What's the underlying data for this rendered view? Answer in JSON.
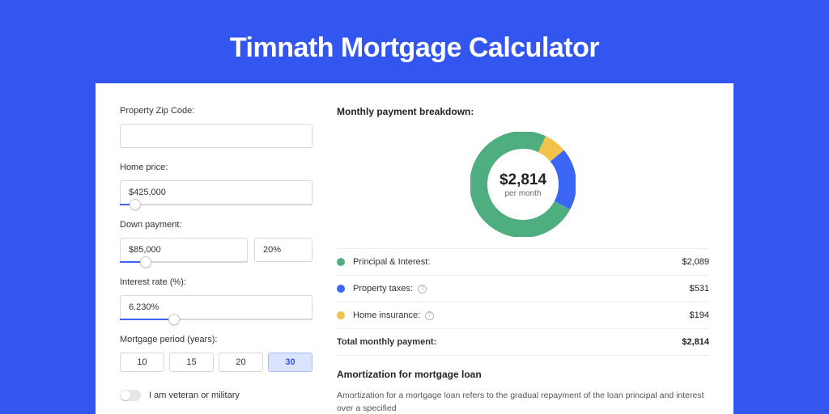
{
  "title": "Timnath Mortgage Calculator",
  "form": {
    "zip": {
      "label": "Property Zip Code:",
      "value": ""
    },
    "home": {
      "label": "Home price:",
      "value": "$425,000",
      "slider_pct": 8
    },
    "down": {
      "label": "Down payment:",
      "amount": "$85,000",
      "pct": "20%",
      "slider_pct": 20
    },
    "rate": {
      "label": "Interest rate (%):",
      "value": "6.230%",
      "slider_pct": 28
    },
    "period": {
      "label": "Mortgage period (years):",
      "options": [
        "10",
        "15",
        "20",
        "30"
      ],
      "selected": "30"
    },
    "veteran": {
      "label": "I am veteran or military"
    }
  },
  "breakdown": {
    "title": "Monthly payment breakdown:",
    "center_amount": "$2,814",
    "center_sub": "per month",
    "rows": [
      {
        "color": "green",
        "label": "Principal & Interest:",
        "info": false,
        "value": "$2,089"
      },
      {
        "color": "blue",
        "label": "Property taxes:",
        "info": true,
        "value": "$531"
      },
      {
        "color": "yellow",
        "label": "Home insurance:",
        "info": true,
        "value": "$194"
      }
    ],
    "total": {
      "label": "Total monthly payment:",
      "value": "$2,814"
    }
  },
  "chart_data": {
    "type": "pie",
    "title": "Monthly payment breakdown",
    "series": [
      {
        "name": "Principal & Interest",
        "value": 2089,
        "color": "#4fae80"
      },
      {
        "name": "Property taxes",
        "value": 531,
        "color": "#3b66f5"
      },
      {
        "name": "Home insurance",
        "value": 194,
        "color": "#f3c24b"
      }
    ],
    "total": 2814
  },
  "amort": {
    "title": "Amortization for mortgage loan",
    "text": "Amortization for a mortgage loan refers to the gradual repayment of the loan principal and interest over a specified"
  }
}
